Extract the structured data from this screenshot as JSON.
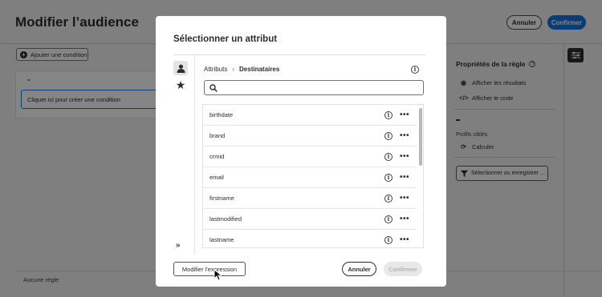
{
  "page": {
    "title": "Modifier l’audience",
    "cancel_label": "Annuler",
    "confirm_label": "Confirmer",
    "accent": "#1473e6",
    "add_condition_label": "Ajouter une condition",
    "click_condition_label": "Cliquer ici pour créer une condition",
    "no_rule_label": "Aucune règle"
  },
  "side_panel": {
    "title": "Propriétés de la règle",
    "show_results_label": "Afficher les résultats",
    "show_code_label": "Afficher le code",
    "value_placeholder": "-",
    "targeted_profiles_label": "Profils ciblés",
    "calculate_label": "Calculer",
    "select_save_label": "Sélectionner ou enregistrer ..."
  },
  "modal": {
    "title": "Sélectionner un attribut",
    "breadcrumb": [
      "Attributs",
      "Destinataires"
    ],
    "search": {
      "value": "",
      "placeholder": ""
    },
    "attributes": [
      {
        "name": "birthdate"
      },
      {
        "name": "brand"
      },
      {
        "name": "crmid"
      },
      {
        "name": "email"
      },
      {
        "name": "firstname"
      },
      {
        "name": "lastmodified"
      },
      {
        "name": "lastname"
      }
    ],
    "edit_expression_label": "Modifier l'expression",
    "cancel_label": "Annuler",
    "confirm_label": "Confirmer",
    "confirm_disabled": true
  },
  "icons": {
    "rail_person": "person-icon",
    "rail_favorites": "star-icon",
    "rail_expand": "double-chevron-right-icon",
    "search": "search-icon",
    "info": "info-icon",
    "more": "more-icon"
  }
}
